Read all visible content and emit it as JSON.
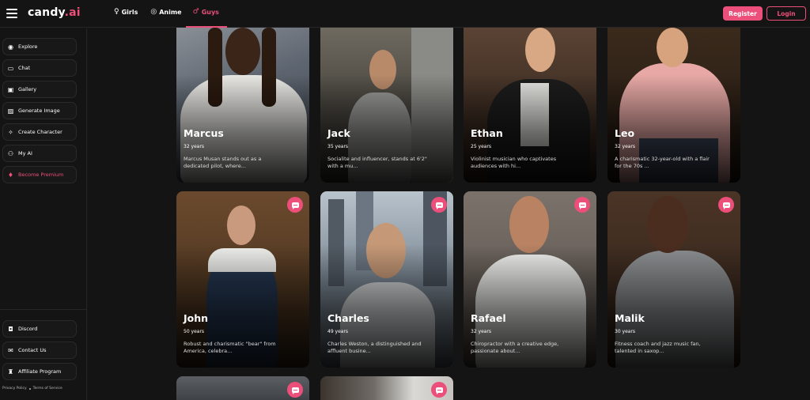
{
  "header": {
    "logo_main": "candy",
    "logo_suffix": ".ai",
    "nav": [
      {
        "label": "Girls",
        "icon": "female-icon"
      },
      {
        "label": "Anime",
        "icon": "anime-icon"
      },
      {
        "label": "Guys",
        "icon": "male-icon",
        "active": true
      }
    ],
    "register_label": "Register",
    "login_label": "Login"
  },
  "sidebar": {
    "items": [
      {
        "label": "Explore",
        "icon": "compass-icon"
      },
      {
        "label": "Chat",
        "icon": "chat-icon"
      },
      {
        "label": "Gallery",
        "icon": "gallery-icon"
      },
      {
        "label": "Generate Image",
        "icon": "image-icon"
      },
      {
        "label": "Create Character",
        "icon": "magic-wand-icon"
      },
      {
        "label": "My AI",
        "icon": "user-group-icon"
      },
      {
        "label": "Become Premium",
        "icon": "diamond-icon"
      }
    ],
    "bottom_items": [
      {
        "label": "Discord",
        "icon": "discord-icon"
      },
      {
        "label": "Contact Us",
        "icon": "mail-icon"
      },
      {
        "label": "Affiliate Program",
        "icon": "trophy-icon"
      }
    ],
    "footer": {
      "privacy": "Privacy Policy",
      "terms": "Terms of Service"
    }
  },
  "characters": [
    {
      "name": "Marcus",
      "age": "32 years",
      "desc_line1": "Marcus Musan stands out as a",
      "desc_line2": "dedicated pilot, where..."
    },
    {
      "name": "Jack",
      "age": "35 years",
      "desc_line1": "Socialite and influencer, stands at 6'2\"",
      "desc_line2": "with a mu..."
    },
    {
      "name": "Ethan",
      "age": "25 years",
      "desc_line1": "Violinist musician who captivates",
      "desc_line2": "audiences with hi..."
    },
    {
      "name": "Leo",
      "age": "32 years",
      "desc_line1": "A charismatic 32-year-old with a flair",
      "desc_line2": "for the 70s ..."
    },
    {
      "name": "John",
      "age": "50 years",
      "desc_line1": "Robust and charismatic \"bear\" from",
      "desc_line2": "America, celebra..."
    },
    {
      "name": "Charles",
      "age": "49 years",
      "desc_line1": "Charles Weston, a distinguished and",
      "desc_line2": "affluent busine..."
    },
    {
      "name": "Rafael",
      "age": "32 years",
      "desc_line1": "Chiropractor with a creative edge,",
      "desc_line2": "passionate about..."
    },
    {
      "name": "Malik",
      "age": "30 years",
      "desc_line1": "Fitness coach and jazz music fan,",
      "desc_line2": "talented in saxop..."
    }
  ],
  "colors": {
    "accent": "#ec4f79",
    "background": "#141414"
  }
}
